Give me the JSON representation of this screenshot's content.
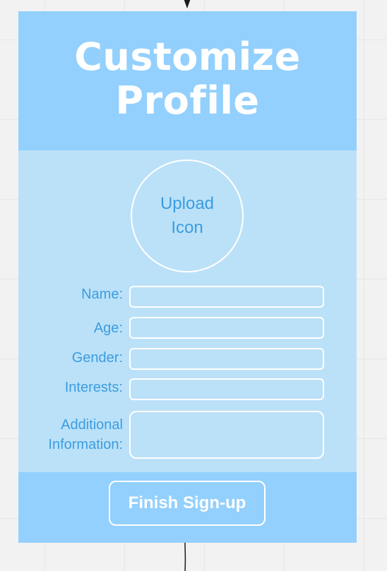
{
  "header": {
    "title": "Customize Profile"
  },
  "upload": {
    "label": "Upload Icon"
  },
  "form": {
    "name_label": "Name:",
    "age_label": "Age:",
    "gender_label": "Gender:",
    "interests_label": "Interests:",
    "additional_label_line1": "Additional",
    "additional_label_line2": "Information:"
  },
  "footer": {
    "finish_label": "Finish Sign-up"
  },
  "colors": {
    "header_bg": "#93d0fd",
    "body_bg": "#bbe1f8",
    "label_text": "#3a9de0",
    "field_border": "#ffffff"
  }
}
